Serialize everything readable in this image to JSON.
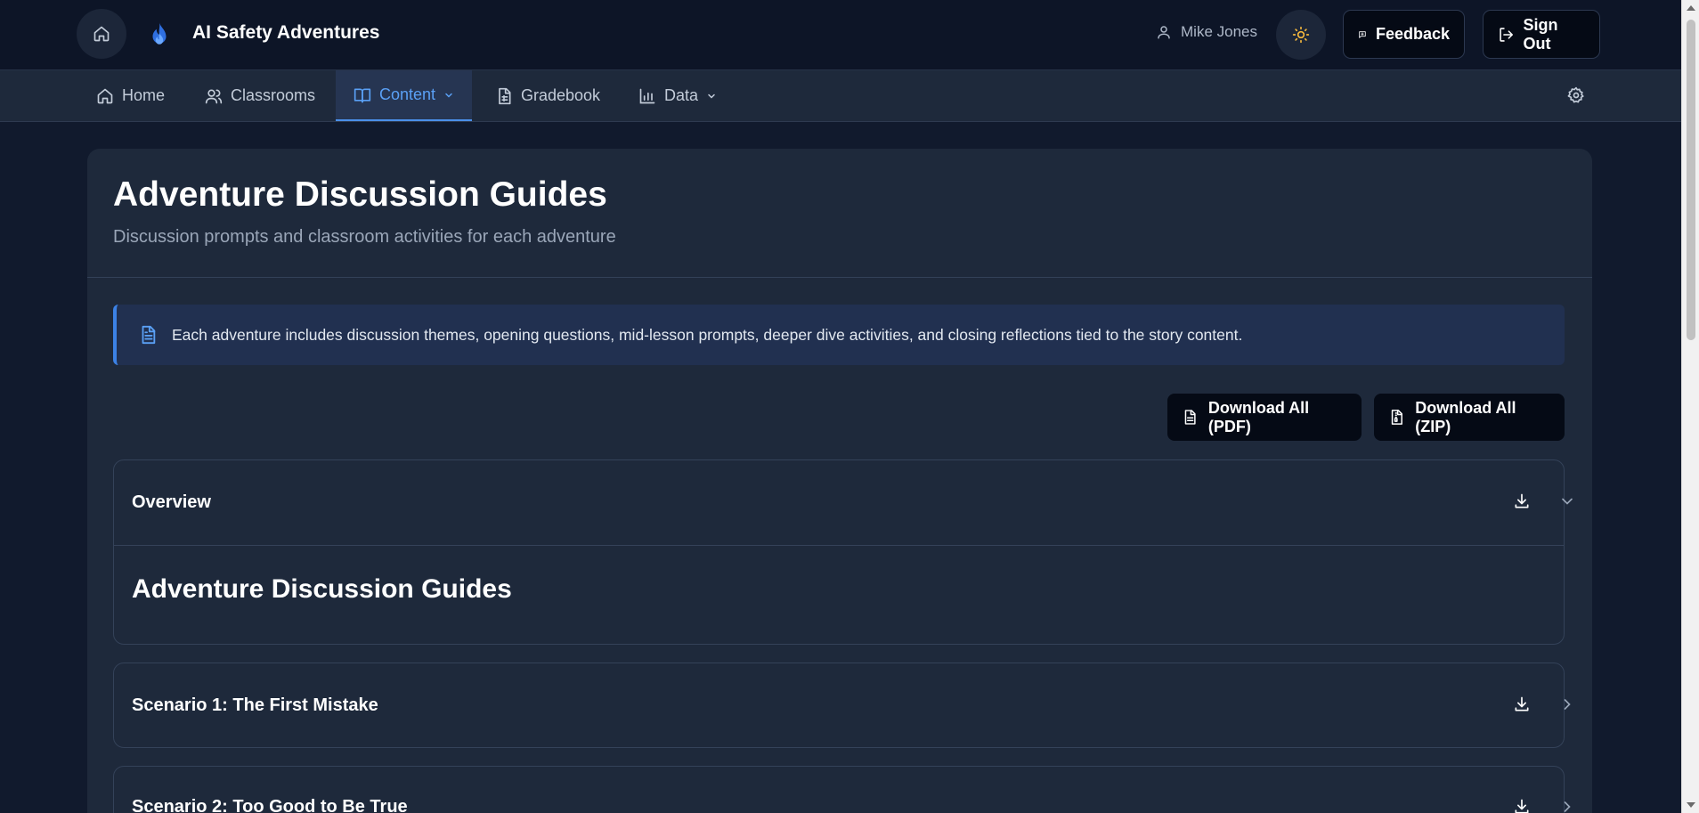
{
  "header": {
    "app_title": "AI Safety Adventures",
    "user_name": "Mike Jones",
    "feedback_label": "Feedback",
    "signout_label": "Sign Out",
    "icons": {
      "home": "home-icon",
      "logo": "flame-logo",
      "user": "user-icon",
      "theme": "sun-icon",
      "feedback": "message-plus-icon",
      "signout": "log-out-icon"
    }
  },
  "nav": {
    "items": [
      {
        "label": "Home",
        "icon": "home-icon"
      },
      {
        "label": "Classrooms",
        "icon": "users-icon"
      },
      {
        "label": "Content",
        "icon": "book-open-icon",
        "active": true,
        "dropdown": true
      },
      {
        "label": "Gradebook",
        "icon": "file-spreadsheet-icon"
      },
      {
        "label": "Data",
        "icon": "bar-chart-icon",
        "dropdown": true
      }
    ],
    "settings_icon": "gear-icon"
  },
  "page": {
    "title": "Adventure Discussion Guides",
    "subtitle": "Discussion prompts and classroom activities for each adventure",
    "info_text": "Each adventure includes discussion themes, opening questions, mid-lesson prompts, deeper dive activities, and closing reflections tied to the story content.",
    "download_pdf_label": "Download All (PDF)",
    "download_zip_label": "Download All (ZIP)"
  },
  "accordion": [
    {
      "title": "Overview",
      "expanded": true,
      "body_title": "Adventure Discussion Guides"
    },
    {
      "title": "Scenario 1: The First Mistake",
      "expanded": false
    },
    {
      "title": "Scenario 2: Too Good to Be True",
      "expanded": false
    }
  ],
  "colors": {
    "background": "#111a2d",
    "card": "#1e293b",
    "accent": "#4b90ea",
    "theme_icon": "#f5b83d"
  }
}
